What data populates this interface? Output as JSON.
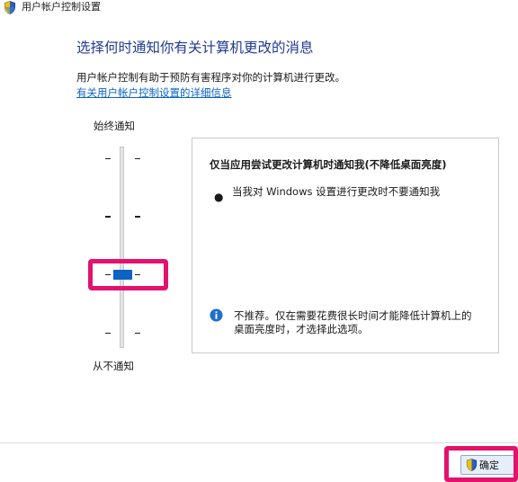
{
  "window": {
    "title": "用户帐户控制设置",
    "title_icon": "uac-shield-icon"
  },
  "main": {
    "heading": "选择何时通知你有关计算机更改的消息",
    "description": "用户帐户控制有助于预防有害程序对你的计算机进行更改。",
    "details_link": "有关用户帐户控制设置的详细信息"
  },
  "slider": {
    "top_label": "始终通知",
    "bottom_label": "从不通知",
    "levels": 4,
    "selected_level": 2
  },
  "panel": {
    "heading": "仅当应用尝试更改计算机时通知我(不降低桌面亮度)",
    "bullet": "当我对 Windows 设置进行更改时不要通知我",
    "info_icon": "info-icon",
    "info_line1": "不推荐。仅在需要花费很长时间才能降低计算机上的",
    "info_line2": "桌面亮度时，才选择此选项。"
  },
  "footer": {
    "ok_label": "确定",
    "ok_icon": "uac-shield-icon"
  },
  "colors": {
    "accent": "#0b63c4",
    "heading": "#1f3a93",
    "highlight": "#e2126d"
  }
}
